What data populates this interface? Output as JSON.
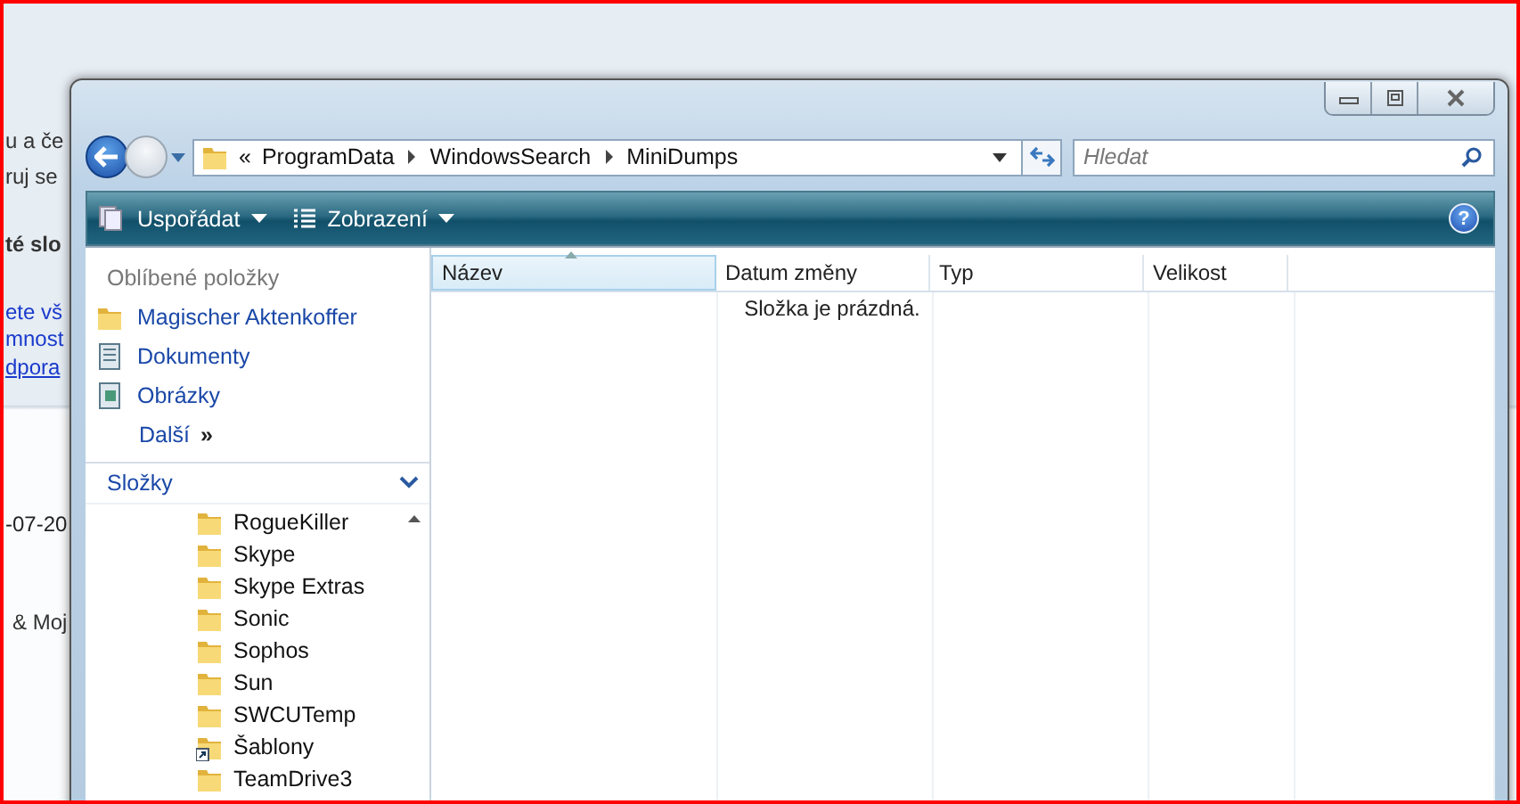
{
  "background_page": {
    "fragments": [
      {
        "text": "u a če",
        "kind": "text"
      },
      {
        "text": "ruj se",
        "kind": "text"
      },
      {
        "text": "té slo",
        "kind": "bold"
      },
      {
        "text": "ete vš",
        "kind": "link"
      },
      {
        "text": "mnost",
        "kind": "link"
      },
      {
        "text": "dpora",
        "kind": "underlined"
      },
      {
        "text": "-07-20",
        "kind": "text"
      },
      {
        "text": "& Moj",
        "kind": "text"
      }
    ]
  },
  "address_bar": {
    "overflow_marker": "«",
    "path": [
      "ProgramData",
      "WindowsSearch",
      "MiniDumps"
    ]
  },
  "search": {
    "placeholder": "Hledat"
  },
  "toolbar": {
    "buttons": [
      {
        "label": "Uspořádat",
        "kind": "organize"
      },
      {
        "label": "Zobrazení",
        "kind": "views"
      }
    ],
    "help_glyph": "?"
  },
  "favorites": {
    "heading": "Oblíbené položky",
    "items": [
      {
        "label": "Magischer Aktenkoffer",
        "kind": "folder"
      },
      {
        "label": "Dokumenty",
        "kind": "documents"
      },
      {
        "label": "Obrázky",
        "kind": "pictures"
      }
    ],
    "more": {
      "label": "Další",
      "glyph": "»"
    }
  },
  "folders": {
    "heading": "Složky",
    "items": [
      {
        "label": "RogueKiller",
        "kind": "folder"
      },
      {
        "label": "Skype",
        "kind": "folder"
      },
      {
        "label": "Skype Extras",
        "kind": "folder"
      },
      {
        "label": "Sonic",
        "kind": "folder"
      },
      {
        "label": "Sophos",
        "kind": "folder"
      },
      {
        "label": "Sun",
        "kind": "folder"
      },
      {
        "label": "SWCUTemp",
        "kind": "folder"
      },
      {
        "label": "Šablony",
        "kind": "shortcut"
      },
      {
        "label": "TeamDrive3",
        "kind": "folder"
      }
    ]
  },
  "file_list": {
    "columns": [
      {
        "label": "Název",
        "sorted": true
      },
      {
        "label": "Datum změny",
        "sorted": false
      },
      {
        "label": "Typ",
        "sorted": false
      },
      {
        "label": "Velikost",
        "sorted": false
      }
    ],
    "empty_message": "Složka je prázdná."
  }
}
